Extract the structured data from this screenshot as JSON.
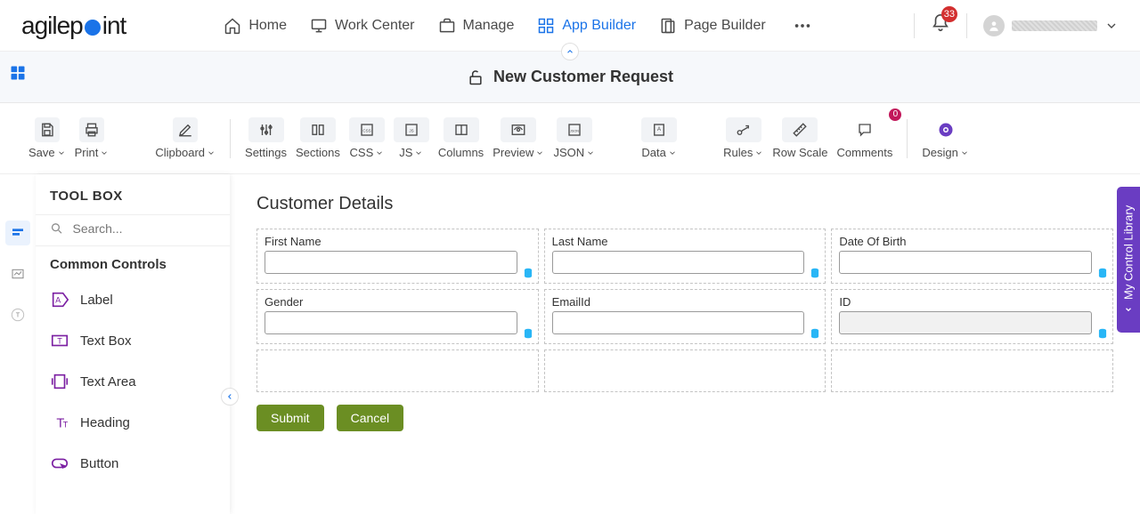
{
  "header": {
    "brand": "agilepoint",
    "nav": [
      {
        "key": "home",
        "label": "Home"
      },
      {
        "key": "workcenter",
        "label": "Work Center"
      },
      {
        "key": "manage",
        "label": "Manage"
      },
      {
        "key": "appbuilder",
        "label": "App Builder"
      },
      {
        "key": "pagebuilder",
        "label": "Page Builder"
      }
    ],
    "notifications_count": "33"
  },
  "subheader": {
    "title": "New Customer Request"
  },
  "toolbar": {
    "save": "Save",
    "print": "Print",
    "clipboard": "Clipboard",
    "settings": "Settings",
    "sections": "Sections",
    "css": "CSS",
    "js": "JS",
    "columns": "Columns",
    "preview": "Preview",
    "json": "JSON",
    "data": "Data",
    "rules": "Rules",
    "rowscale": "Row Scale",
    "comments": "Comments",
    "comments_count": "0",
    "design": "Design"
  },
  "sidebar": {
    "title": "TOOL BOX",
    "search_placeholder": "Search...",
    "group_title": "Common Controls",
    "controls": [
      {
        "key": "label",
        "label": "Label"
      },
      {
        "key": "textbox",
        "label": "Text Box"
      },
      {
        "key": "textarea",
        "label": "Text Area"
      },
      {
        "key": "heading",
        "label": "Heading"
      },
      {
        "key": "button",
        "label": "Button"
      }
    ]
  },
  "canvas": {
    "section_title": "Customer Details",
    "fields": [
      {
        "key": "firstname",
        "label": "First Name",
        "disabled": false
      },
      {
        "key": "lastname",
        "label": "Last Name",
        "disabled": false
      },
      {
        "key": "dob",
        "label": "Date Of Birth",
        "disabled": false
      },
      {
        "key": "gender",
        "label": "Gender",
        "disabled": false
      },
      {
        "key": "emailid",
        "label": "EmailId",
        "disabled": false
      },
      {
        "key": "id",
        "label": "ID",
        "disabled": true
      }
    ],
    "submit_label": "Submit",
    "cancel_label": "Cancel"
  },
  "side_tab": {
    "label": "My Control Library"
  },
  "colors": {
    "accent": "#1a73e8",
    "purple": "#6a3dc2",
    "badge_red": "#d32f2f",
    "badge_pink": "#c2185b",
    "btn_green": "#6b8e23"
  }
}
